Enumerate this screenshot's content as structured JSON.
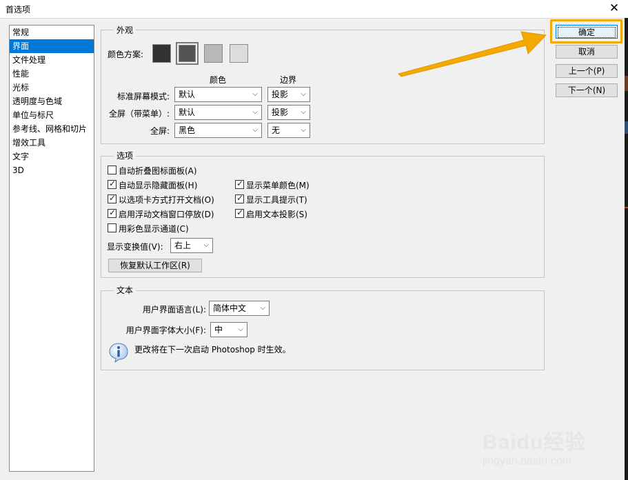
{
  "window": {
    "title": "首选项",
    "close_glyph": "✕"
  },
  "sidebar": {
    "items": [
      "常规",
      "界面",
      "文件处理",
      "性能",
      "光标",
      "透明度与色域",
      "单位与标尺",
      "参考线、网格和切片",
      "增效工具",
      "文字",
      "3D"
    ],
    "selected_index": 1
  },
  "appearance": {
    "title": "外观",
    "color_scheme_label": "颜色方案:",
    "swatch_colors": [
      "#323232",
      "#535353",
      "#b8b8b8",
      "#dcdcdc"
    ],
    "selected_swatch": 1,
    "col_color": "颜色",
    "col_border": "边界",
    "rows": [
      {
        "label": "标准屏幕模式:",
        "color": "默认",
        "border": "投影"
      },
      {
        "label": "全屏（带菜单）:",
        "color": "默认",
        "border": "投影"
      },
      {
        "label": "全屏:",
        "color": "黑色",
        "border": "无"
      }
    ]
  },
  "options": {
    "title": "选项",
    "checkboxes": [
      {
        "label": "自动折叠图标面板(A)",
        "checked": false
      },
      {
        "label": "自动显示隐藏面板(H)",
        "checked": true
      },
      {
        "label": "以选项卡方式打开文档(O)",
        "checked": true
      },
      {
        "label": "启用浮动文档窗口停放(D)",
        "checked": true
      },
      {
        "label": "用彩色显示通道(C)",
        "checked": false
      },
      {
        "label": "显示菜单颜色(M)",
        "checked": true
      },
      {
        "label": "显示工具提示(T)",
        "checked": true
      },
      {
        "label": "启用文本投影(S)",
        "checked": true
      }
    ],
    "transform_label": "显示变换值(V):",
    "transform_value": "右上",
    "restore_button": "恢复默认工作区(R)"
  },
  "text_section": {
    "title": "文本",
    "language_label": "用户界面语言(L):",
    "language_value": "简体中文",
    "font_size_label": "用户界面字体大小(F):",
    "font_size_value": "中",
    "info_text": "更改将在下一次启动 Photoshop 时生效。"
  },
  "buttons": {
    "ok": "确定",
    "cancel": "取消",
    "prev": "上一个(P)",
    "next": "下一个(N)"
  },
  "highlight_color": "#f5a800",
  "watermark": {
    "logo": "Baidu经验",
    "url": "jingyan.baidu.com"
  }
}
